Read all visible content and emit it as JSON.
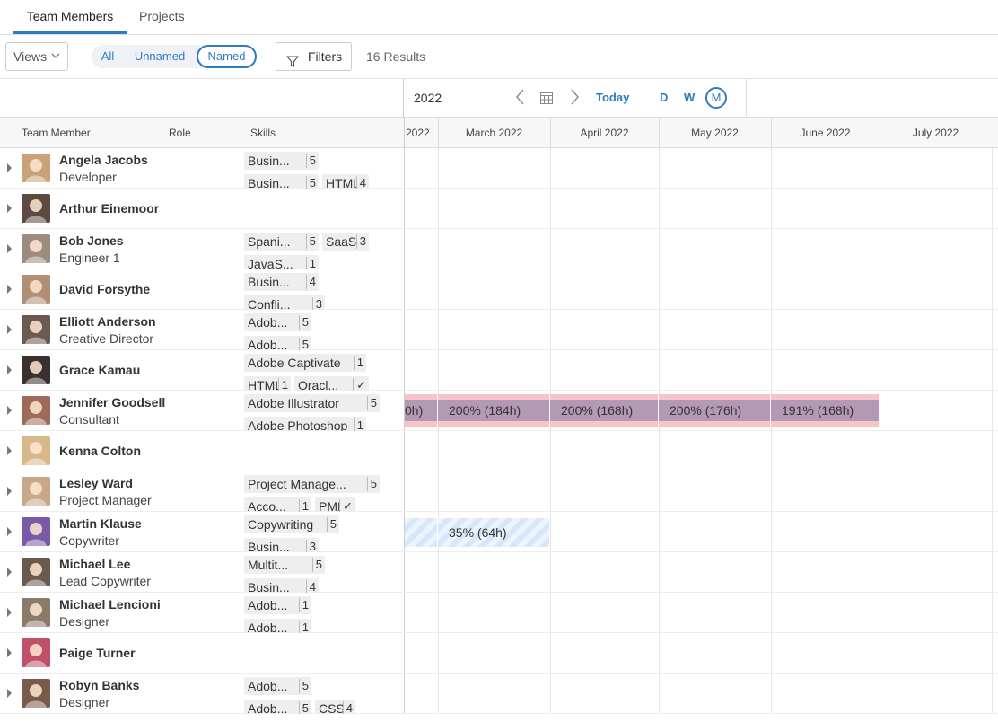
{
  "tabs": [
    {
      "label": "Team Members",
      "active": true
    },
    {
      "label": "Projects",
      "active": false
    }
  ],
  "toolbar": {
    "views_label": "Views",
    "segments": [
      {
        "label": "All",
        "active": false
      },
      {
        "label": "Unnamed",
        "active": false
      },
      {
        "label": "Named",
        "active": true
      }
    ],
    "filters_label": "Filters",
    "results_text": "16 Results"
  },
  "timeline": {
    "year": "2022",
    "today_label": "Today",
    "scales": [
      "D",
      "W",
      "M"
    ],
    "active_scale": "M",
    "months": [
      "2022",
      "March 2022",
      "April 2022",
      "May 2022",
      "June 2022",
      "July 2022"
    ]
  },
  "columns": {
    "member": "Team Member",
    "role": "Role",
    "skills": "Skills"
  },
  "colors": {
    "accent": "#2f7bbf",
    "over_allocation": "#b399b3",
    "over_border": "#f7c4c8",
    "under_allocation": "#d6e6fb"
  },
  "members": [
    {
      "name": "Angela Jacobs",
      "role": "Developer",
      "avatar": "#c9a27a",
      "skills": [
        [
          {
            "t": "Busin...",
            "l": "5"
          }
        ],
        [
          {
            "t": "Busin...",
            "l": "5"
          },
          {
            "t": "HTML",
            "l": "4"
          }
        ]
      ]
    },
    {
      "name": "Arthur Einemoor",
      "role": "",
      "avatar": "#5a4a40",
      "skills": []
    },
    {
      "name": "Bob Jones",
      "role": "Engineer 1",
      "avatar": "#9b8c7e",
      "skills": [
        [
          {
            "t": "Spani...",
            "l": "5"
          },
          {
            "t": "SaaS",
            "l": "3"
          }
        ],
        [
          {
            "t": "JavaS...",
            "l": "1"
          }
        ]
      ]
    },
    {
      "name": "David Forsythe",
      "role": "",
      "avatar": "#b08f74",
      "skills": [
        [
          {
            "t": "Busin...",
            "l": "4"
          }
        ],
        [
          {
            "t": "Confli...",
            "l": "3"
          }
        ]
      ]
    },
    {
      "name": "Elliott Anderson",
      "role": "Creative Director",
      "avatar": "#6b5a50",
      "skills": [
        [
          {
            "t": "Adob...",
            "l": "5"
          }
        ],
        [
          {
            "t": "Adob...",
            "l": "5"
          }
        ]
      ]
    },
    {
      "name": "Grace Kamau",
      "role": "",
      "avatar": "#3a3030",
      "skills": [
        [
          {
            "t": "Adobe Captivate",
            "l": "1"
          }
        ],
        [
          {
            "t": "HTML",
            "l": "1"
          },
          {
            "t": "Oracl...",
            "l": "✓"
          }
        ]
      ]
    },
    {
      "name": "Jennifer Goodsell",
      "role": "Consultant",
      "avatar": "#a06a5a",
      "skills": [
        [
          {
            "t": "Adobe Illustrator",
            "l": "5"
          }
        ],
        [
          {
            "t": "Adobe Photoshop",
            "l": "1"
          }
        ]
      ],
      "allocations": [
        {
          "label": "0h)",
          "month": 0,
          "kind": "over"
        },
        {
          "label": "200% (184h)",
          "month": 1,
          "kind": "over"
        },
        {
          "label": "200% (168h)",
          "month": 2,
          "kind": "over"
        },
        {
          "label": "200% (176h)",
          "month": 3,
          "kind": "over"
        },
        {
          "label": "191% (168h)",
          "month": 4,
          "kind": "over"
        }
      ]
    },
    {
      "name": "Kenna Colton",
      "role": "",
      "avatar": "#d8b88a",
      "skills": []
    },
    {
      "name": "Lesley Ward",
      "role": "Project Manager",
      "avatar": "#c8a888",
      "skills": [
        [
          {
            "t": "Project Manage...",
            "l": "5"
          }
        ],
        [
          {
            "t": "Acco...",
            "l": "1"
          },
          {
            "t": "PMP",
            "l": "✓"
          }
        ]
      ]
    },
    {
      "name": "Martin Klause",
      "role": "Copywriter",
      "avatar": "#7a5aa8",
      "skills": [
        [
          {
            "t": "Copywriting",
            "l": "5"
          }
        ],
        [
          {
            "t": "Busin...",
            "l": "3"
          }
        ]
      ],
      "allocations": [
        {
          "label": "",
          "month": 0,
          "kind": "under"
        },
        {
          "label": "35% (64h)",
          "month": 1,
          "kind": "under"
        }
      ]
    },
    {
      "name": "Michael Lee",
      "role": "Lead Copywriter",
      "avatar": "#6a5a4e",
      "skills": [
        [
          {
            "t": "Multit...",
            "l": "5"
          }
        ],
        [
          {
            "t": "Busin...",
            "l": "4"
          }
        ]
      ]
    },
    {
      "name": "Michael Lencioni",
      "role": "Designer",
      "avatar": "#8a7a6a",
      "skills": [
        [
          {
            "t": "Adob...",
            "l": "1"
          }
        ],
        [
          {
            "t": "Adob...",
            "l": "1"
          }
        ]
      ]
    },
    {
      "name": "Paige Turner",
      "role": "",
      "avatar": "#c0506a",
      "skills": []
    },
    {
      "name": "Robyn Banks",
      "role": "Designer",
      "avatar": "#7a5a4a",
      "skills": [
        [
          {
            "t": "Adob...",
            "l": "5"
          }
        ],
        [
          {
            "t": "Adob...",
            "l": "5"
          },
          {
            "t": "CSS",
            "l": "4"
          }
        ]
      ]
    }
  ]
}
